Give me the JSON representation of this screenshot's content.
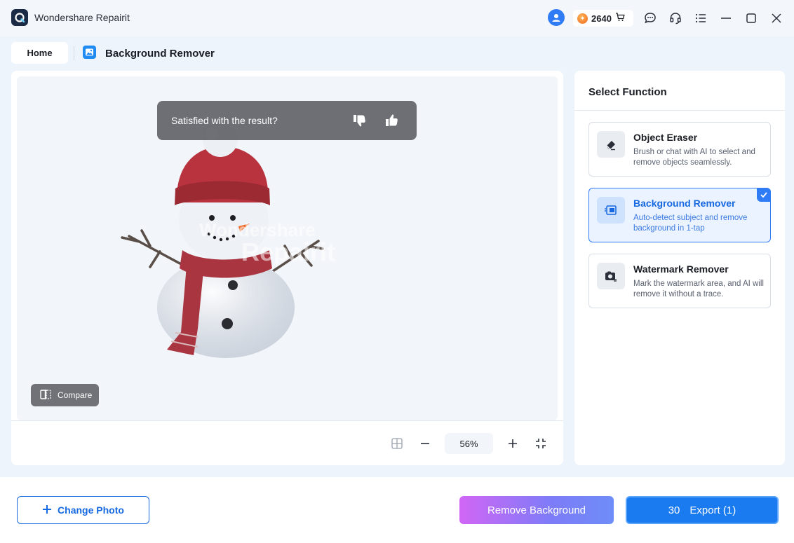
{
  "app": {
    "title": "Wondershare Repairit",
    "credits": "2640"
  },
  "tabs": {
    "home_label": "Home",
    "page_title": "Background Remover"
  },
  "canvas": {
    "feedback_text": "Satisfied with the result?",
    "compare_label": "Compare",
    "watermark_line1": "Wondershare",
    "watermark_line2": "Repairit",
    "zoom_value": "56%"
  },
  "function_panel": {
    "title": "Select Function",
    "items": [
      {
        "name": "Object Eraser",
        "description": "Brush or chat with AI to select and remove objects seamlessly.",
        "icon": "eraser-icon",
        "selected": false
      },
      {
        "name": "Background Remover",
        "description": "Auto-detect subject and remove background in 1-tap",
        "icon": "background-remover-icon",
        "selected": true
      },
      {
        "name": "Watermark Remover",
        "description": "Mark the watermark area, and AI will remove it without a trace.",
        "icon": "watermark-remover-icon",
        "selected": false
      }
    ]
  },
  "footer": {
    "change_photo_label": "Change Photo",
    "remove_background_label": "Remove Background",
    "export_count": "30",
    "export_label": "Export (1)"
  },
  "colors": {
    "accent": "#1668e0",
    "selected_border": "#2f7cf6",
    "export_button": "#1a7af0",
    "remove_gradient_start": "#d166f5",
    "remove_gradient_end": "#6e8df8"
  }
}
